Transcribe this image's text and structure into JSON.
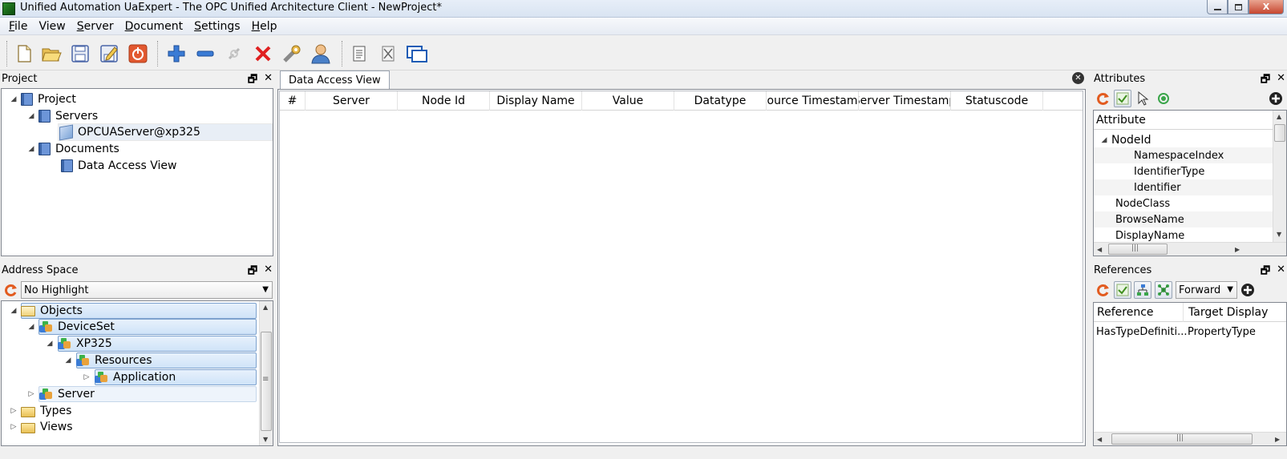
{
  "window": {
    "title": "Unified Automation UaExpert - The OPC Unified Architecture Client - NewProject*",
    "minimize_icon": "minimize-icon",
    "maximize_icon": "maximize-icon",
    "close_label": "X"
  },
  "menu": [
    {
      "first": "F",
      "rest": "ile"
    },
    {
      "first": "",
      "rest": "View"
    },
    {
      "first": "S",
      "rest": "erver"
    },
    {
      "first": "D",
      "rest": "ocument"
    },
    {
      "first": "S",
      "rest": "ettings"
    },
    {
      "first": "H",
      "rest": "elp"
    }
  ],
  "toolbar": {
    "icons": [
      "new-project-icon",
      "open-project-icon",
      "save-project-icon",
      "save-as-icon",
      "disconnect-icon",
      "add-server-icon",
      "remove-server-icon",
      "connect-icon",
      "delete-icon",
      "settings-wrench-icon",
      "user-icon",
      "document-icon",
      "remove-document-icon",
      "window-icon"
    ]
  },
  "project_panel": {
    "title": "Project",
    "tree": [
      {
        "label": "Project"
      },
      {
        "label": "Servers"
      },
      {
        "label": "OPCUAServer@xp325"
      },
      {
        "label": "Documents"
      },
      {
        "label": "Data Access View"
      }
    ]
  },
  "address_panel": {
    "title": "Address Space",
    "highlight_value": "No Highlight",
    "tree": [
      {
        "label": "Objects"
      },
      {
        "label": "DeviceSet"
      },
      {
        "label": "XP325"
      },
      {
        "label": "Resources"
      },
      {
        "label": "Application"
      },
      {
        "label": "Server"
      },
      {
        "label": "Types"
      },
      {
        "label": "Views"
      }
    ]
  },
  "data_access_view": {
    "tab_label": "Data Access View",
    "columns": [
      "#",
      "Server",
      "Node Id",
      "Display Name",
      "Value",
      "Datatype",
      "Source Timestamp",
      "Server Timestamp",
      "Statuscode"
    ]
  },
  "attributes_panel": {
    "title": "Attributes",
    "header": "Attribute",
    "rows": [
      {
        "label": "NodeId"
      },
      {
        "label": "NamespaceIndex"
      },
      {
        "label": "IdentifierType"
      },
      {
        "label": "Identifier"
      },
      {
        "label": "NodeClass"
      },
      {
        "label": "BrowseName"
      },
      {
        "label": "DisplayName"
      }
    ]
  },
  "references_panel": {
    "title": "References",
    "direction": "Forward",
    "columns": [
      "Reference",
      "Target Display"
    ],
    "rows": [
      {
        "reference": "HasTypeDefiniti...",
        "target": "PropertyType"
      }
    ]
  },
  "scroll": {
    "grip": "|||",
    "grip_v": "≡"
  },
  "colors": {
    "selection": "#cfe3f8",
    "accent_red": "#d9534f",
    "accent_blue": "#3a7bd5"
  }
}
